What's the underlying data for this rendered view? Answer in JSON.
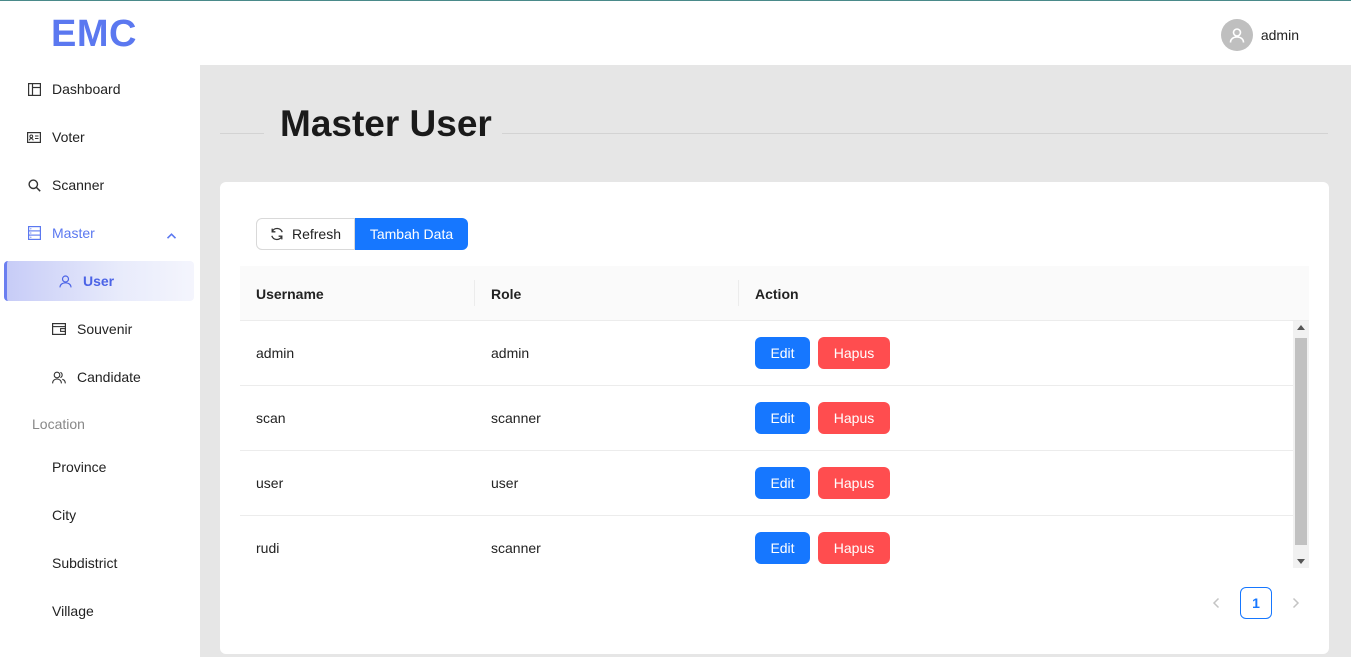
{
  "app": {
    "logo": "EMC"
  },
  "header": {
    "username": "admin",
    "avatar_icon": "user-avatar-icon"
  },
  "sidebar": {
    "items": [
      {
        "label": "Dashboard",
        "icon": "dashboard-icon"
      },
      {
        "label": "Voter",
        "icon": "id-card-icon"
      },
      {
        "label": "Scanner",
        "icon": "search-icon"
      },
      {
        "label": "Master",
        "icon": "database-icon",
        "expanded": true
      },
      {
        "label": "User",
        "icon": "user-icon",
        "active": true
      },
      {
        "label": "Souvenir",
        "icon": "wallet-icon"
      },
      {
        "label": "Candidate",
        "icon": "team-icon"
      }
    ],
    "group_label": "Location",
    "location_items": [
      {
        "label": "Province"
      },
      {
        "label": "City"
      },
      {
        "label": "Subdistrict"
      },
      {
        "label": "Village"
      }
    ]
  },
  "main": {
    "title": "Master User",
    "toolbar": {
      "refresh_label": "Refresh",
      "add_label": "Tambah Data"
    },
    "table": {
      "columns": [
        "Username",
        "Role",
        "Action"
      ],
      "rows": [
        {
          "username": "admin",
          "role": "admin"
        },
        {
          "username": "scan",
          "role": "scanner"
        },
        {
          "username": "user",
          "role": "user"
        },
        {
          "username": "rudi",
          "role": "scanner"
        }
      ],
      "edit_label": "Edit",
      "delete_label": "Hapus"
    },
    "pagination": {
      "current_page": "1"
    }
  },
  "colors": {
    "accent": "#5b78f0",
    "primary": "#1677ff",
    "danger": "#ff4d4f"
  }
}
